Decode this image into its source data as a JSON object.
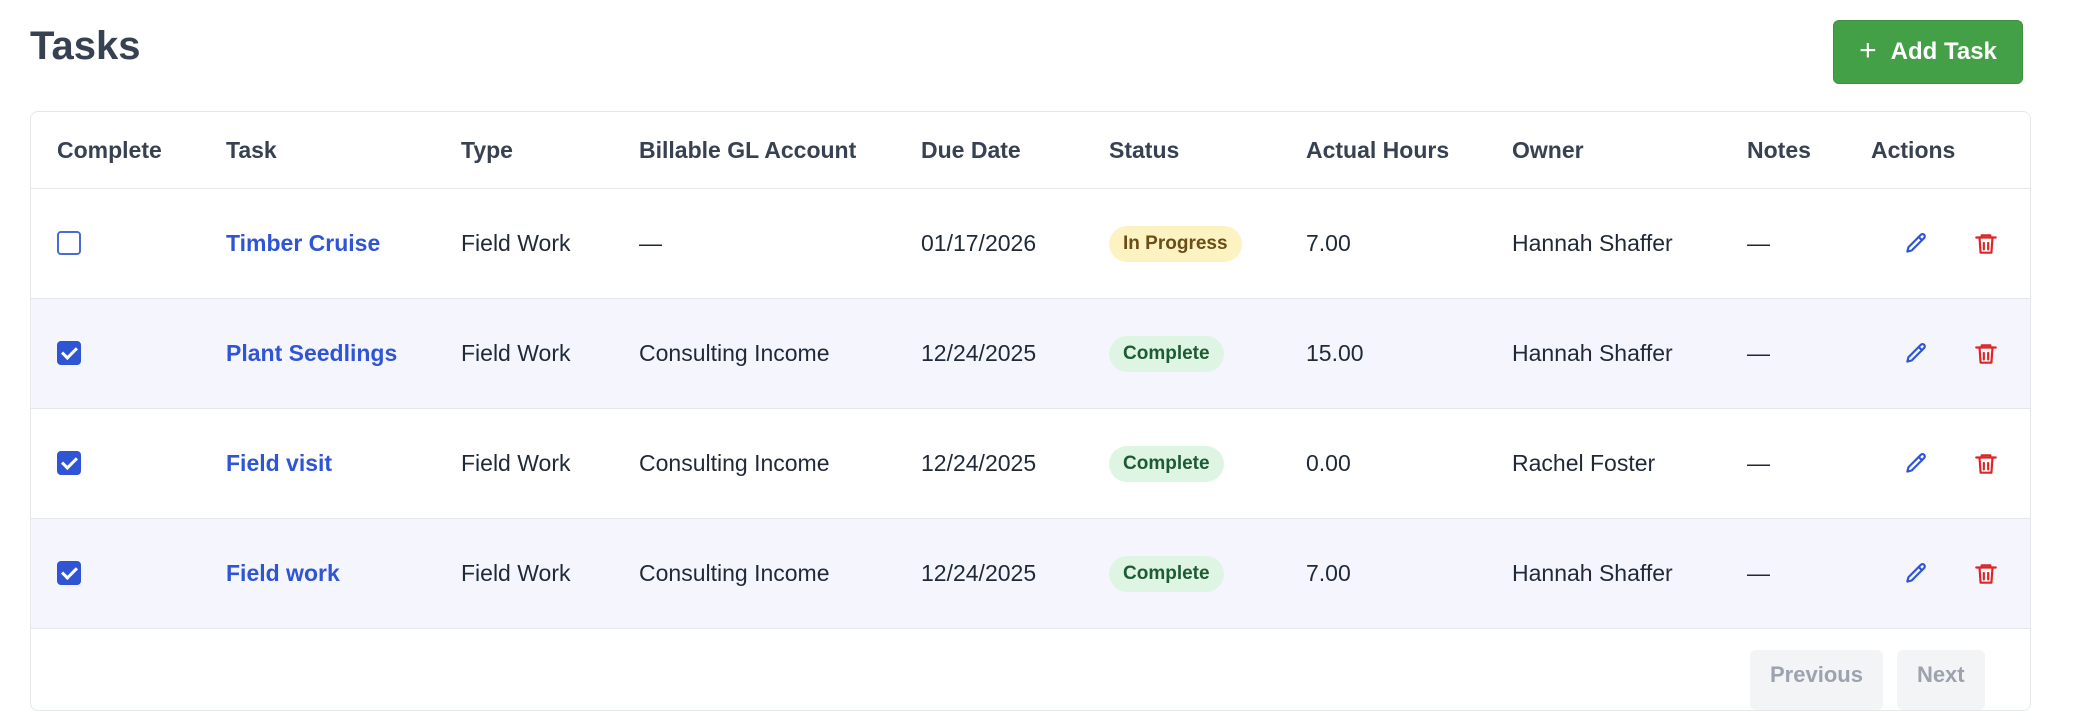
{
  "page": {
    "title": "Tasks",
    "add_button": "Add Task"
  },
  "table": {
    "columns": [
      "Complete",
      "Task",
      "Type",
      "Billable GL Account",
      "Due Date",
      "Status",
      "Actual Hours",
      "Owner",
      "Notes",
      "Actions"
    ],
    "rows": [
      {
        "complete": false,
        "task": "Timber Cruise",
        "type": "Field Work",
        "gl_account": "—",
        "due_date": "01/17/2026",
        "status": "In Progress",
        "hours": "7.00",
        "owner": "Hannah Shaffer",
        "notes": "—"
      },
      {
        "complete": true,
        "task": "Plant Seedlings",
        "type": "Field Work",
        "gl_account": "Consulting Income",
        "due_date": "12/24/2025",
        "status": "Complete",
        "hours": "15.00",
        "owner": "Hannah Shaffer",
        "notes": "—"
      },
      {
        "complete": true,
        "task": "Field visit",
        "type": "Field Work",
        "gl_account": "Consulting Income",
        "due_date": "12/24/2025",
        "status": "Complete",
        "hours": "0.00",
        "owner": "Rachel Foster",
        "notes": "—"
      },
      {
        "complete": true,
        "task": "Field work",
        "type": "Field Work",
        "gl_account": "Consulting Income",
        "due_date": "12/24/2025",
        "status": "Complete",
        "hours": "7.00",
        "owner": "Hannah Shaffer",
        "notes": "—"
      }
    ]
  },
  "pagination": {
    "previous": "Previous",
    "next": "Next"
  },
  "colors": {
    "primary": "#43a047",
    "link": "#2f55d4",
    "delete": "#dc2626",
    "in_progress_bg": "#fdf3c2",
    "complete_bg": "#def5e4"
  },
  "icons": {
    "edit": "pencil-icon",
    "delete": "trash-icon",
    "add": "plus-icon"
  }
}
